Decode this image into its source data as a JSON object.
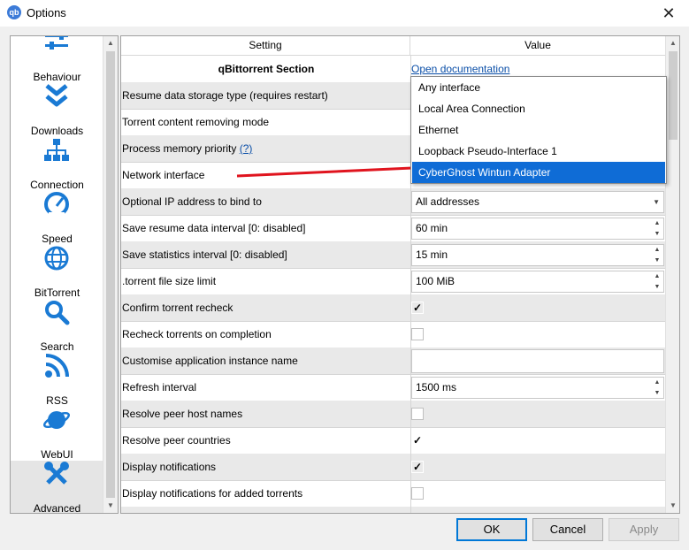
{
  "window": {
    "title": "Options",
    "app_icon": "qb",
    "close": "✕"
  },
  "sidebar": {
    "items": [
      {
        "label": "Behaviour",
        "icon": "sliders-icon"
      },
      {
        "label": "Downloads",
        "icon": "double-chevron-down-icon"
      },
      {
        "label": "Connection",
        "icon": "network-tree-icon"
      },
      {
        "label": "Speed",
        "icon": "speedometer-icon"
      },
      {
        "label": "BitTorrent",
        "icon": "globe-icon"
      },
      {
        "label": "Search",
        "icon": "magnifier-icon"
      },
      {
        "label": "RSS",
        "icon": "rss-icon"
      },
      {
        "label": "WebUI",
        "icon": "planet-icon"
      },
      {
        "label": "Advanced",
        "icon": "tools-icon"
      }
    ],
    "selected": "Advanced"
  },
  "table": {
    "headers": {
      "setting": "Setting",
      "value": "Value"
    },
    "rows": [
      {
        "setting": "qBittorrent Section",
        "value": "Open documentation"
      },
      {
        "setting": "Resume data storage type (requires restart)",
        "value": ""
      },
      {
        "setting": "Torrent content removing mode",
        "value": ""
      },
      {
        "setting": "Process memory priority",
        "hint": "(?)",
        "value": ""
      },
      {
        "setting": "Network interface",
        "value": ""
      },
      {
        "setting": "Optional IP address to bind to",
        "value": "All addresses"
      },
      {
        "setting": "Save resume data interval [0: disabled]",
        "value": "60 min"
      },
      {
        "setting": "Save statistics interval [0: disabled]",
        "value": "15 min"
      },
      {
        "setting": ".torrent file size limit",
        "value": "100 MiB"
      },
      {
        "setting": "Confirm torrent recheck",
        "checked": true
      },
      {
        "setting": "Recheck torrents on completion",
        "checked": false
      },
      {
        "setting": "Customise application instance name",
        "value": ""
      },
      {
        "setting": "Refresh interval",
        "value": "1500 ms"
      },
      {
        "setting": "Resolve peer host names",
        "checked": false
      },
      {
        "setting": "Resolve peer countries",
        "checked": true
      },
      {
        "setting": "Display notifications",
        "checked": true
      },
      {
        "setting": "Display notifications for added torrents",
        "checked": false
      }
    ]
  },
  "dropdown": {
    "options": [
      "Any interface",
      "Local Area Connection",
      "Ethernet",
      "Loopback Pseudo-Interface 1",
      "CyberGhost Wintun Adapter"
    ],
    "highlighted": "CyberGhost Wintun Adapter"
  },
  "buttons": {
    "ok": "OK",
    "cancel": "Cancel",
    "apply": "Apply"
  },
  "glyphs": {
    "check": "✓",
    "combo_arrow": "▼",
    "spin_up": "▲",
    "spin_down": "▼",
    "scroll_up": "▲",
    "scroll_down": "▼"
  },
  "colors": {
    "selection": "#0f6cd6",
    "link": "#0b4fa8",
    "annotation": "#e0141e",
    "icon_blue": "#1a7ad4"
  }
}
